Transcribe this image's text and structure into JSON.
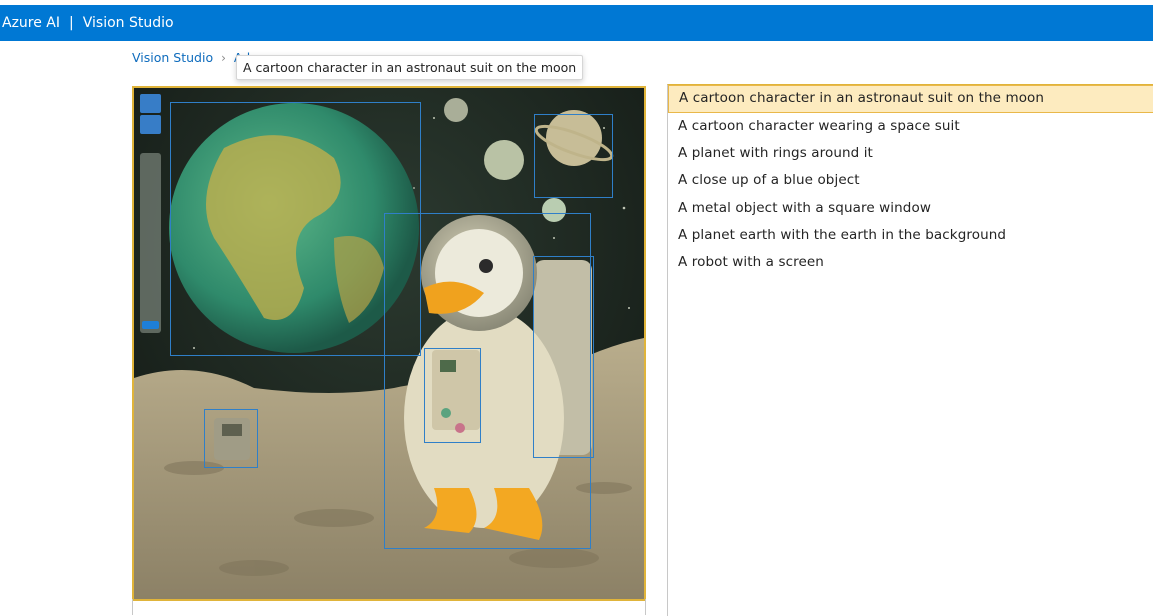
{
  "header": {
    "brand": "Azure AI",
    "separator": "|",
    "product": "Vision Studio"
  },
  "breadcrumb": {
    "home": "Vision Studio",
    "current_visible": "Ad"
  },
  "tooltip": {
    "text": "A cartoon character in an astronaut suit on the moon"
  },
  "image_view": {
    "zoom_slider_value": 0.0
  },
  "captions": {
    "selected_index": 0,
    "items": [
      "A cartoon character in an astronaut suit on the moon",
      "A cartoon character wearing a space suit",
      "A planet with rings around it",
      "A close up of a blue object",
      "A metal object with a square window",
      "A planet earth with the earth in the background",
      "A robot with a screen"
    ]
  },
  "colors": {
    "topbar": "#0078d4",
    "link": "#0f6cbd",
    "selected_bg": "#fdebbf",
    "selected_border": "#e9b84a",
    "bbox": "#2f7fc8"
  }
}
